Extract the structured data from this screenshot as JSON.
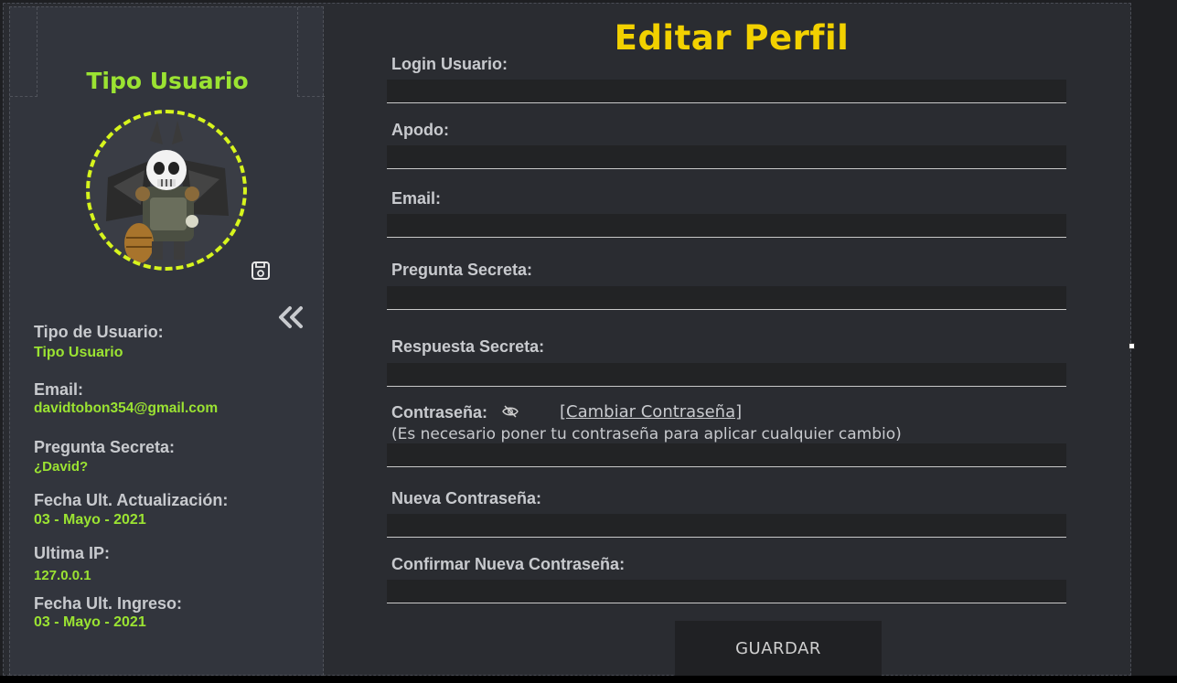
{
  "sidebar": {
    "title": "Tipo Usuario",
    "info": [
      {
        "label": "Tipo de Usuario:",
        "value": "Tipo Usuario"
      },
      {
        "label": "Email:",
        "value": "davidtobon354@gmail.com"
      },
      {
        "label": "Pregunta Secreta:",
        "value": "¿David?"
      },
      {
        "label": "Fecha Ult. Actualización:",
        "value": "03 - Mayo - 2021"
      },
      {
        "label": "Ultima IP:",
        "value": "127.0.0.1"
      },
      {
        "label": "Fecha Ult. Ingreso:",
        "value": "03 - Mayo - 2021"
      }
    ],
    "icons": {
      "save": "save-icon",
      "collapse": "double-chevron-left-icon",
      "avatar": "avatar-image"
    }
  },
  "form": {
    "title": "Editar Perfil",
    "fields": [
      {
        "label": "Login Usuario:",
        "value": ""
      },
      {
        "label": "Apodo:",
        "value": ""
      },
      {
        "label": "Email:",
        "value": ""
      },
      {
        "label": "Pregunta Secreta:",
        "value": ""
      },
      {
        "label": "Respuesta Secreta:",
        "value": ""
      },
      {
        "label": "Contraseña:",
        "value": ""
      },
      {
        "label": "Nueva Contraseña:",
        "value": ""
      },
      {
        "label": "Confirmar Nueva Contraseña:",
        "value": ""
      }
    ],
    "change_password_link": "[Cambiar Contraseña]",
    "password_note": "(Es necesario poner tu contraseña para aplicar cualquier cambio)",
    "save_label": "GUARDAR",
    "icons": {
      "toggle_visibility": "eye-slash-icon"
    }
  },
  "colors": {
    "accent_green": "#9be332",
    "title_yellow": "#f2d100",
    "ring_yellow": "#d7f51d",
    "panel_bg": "#32353d",
    "main_bg": "#2a2c31",
    "input_bg": "#222325"
  }
}
